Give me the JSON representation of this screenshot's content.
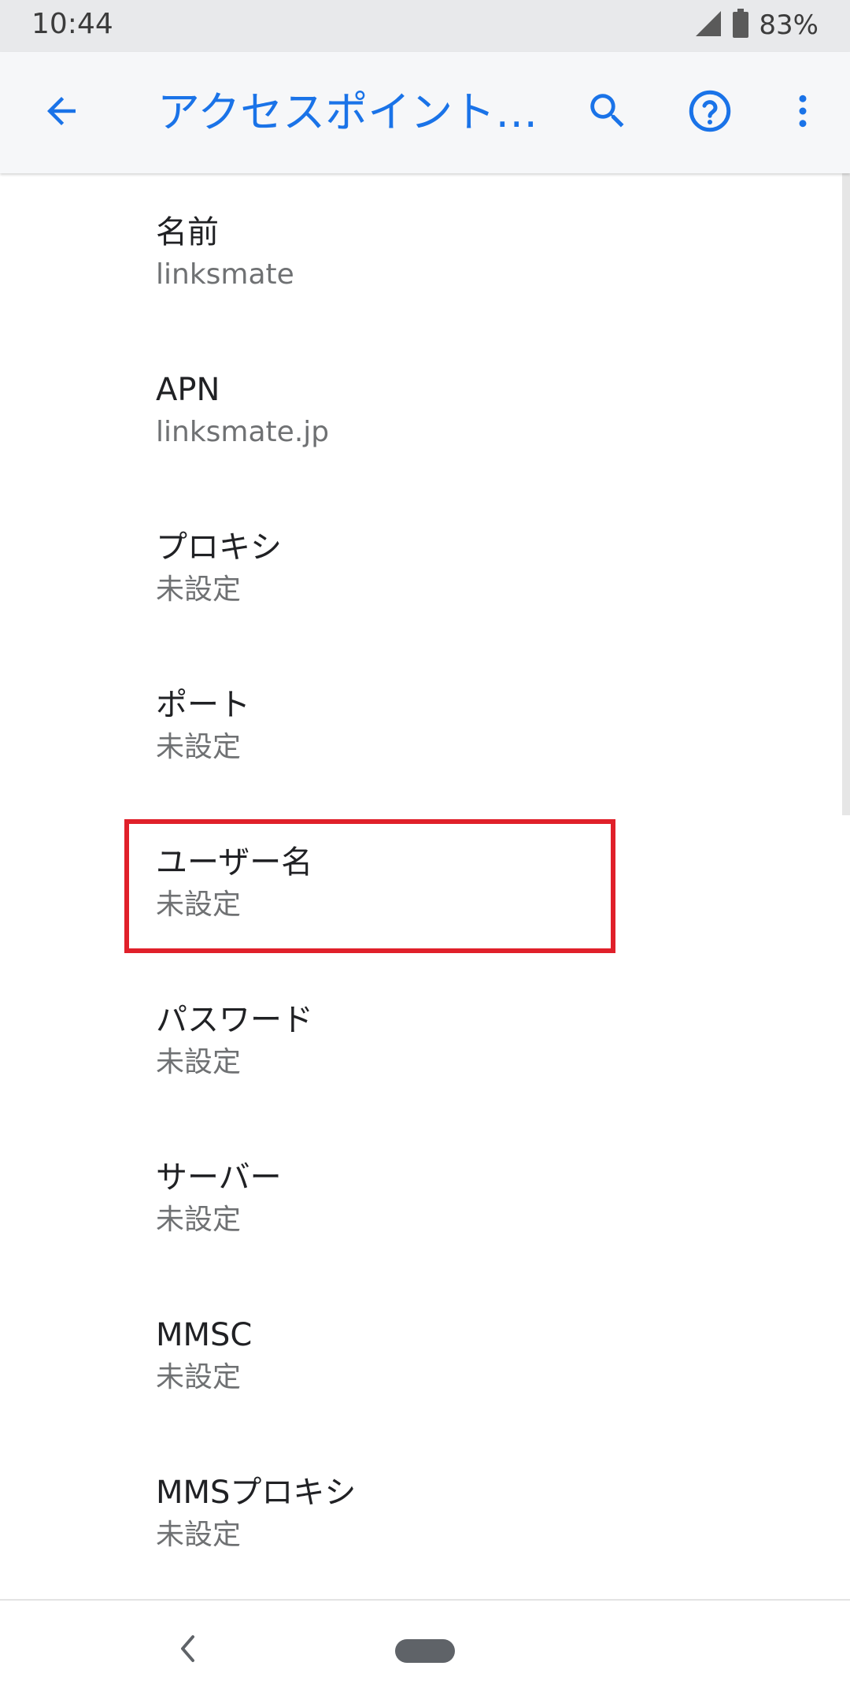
{
  "status_bar": {
    "time": "10:44",
    "battery": "83%",
    "icons": [
      "signal-icon",
      "battery-icon"
    ]
  },
  "app_bar": {
    "title": "アクセスポイント…",
    "icons": [
      "back-arrow-icon",
      "search-icon",
      "help-icon",
      "more-vert-icon"
    ],
    "accent_color": "#1a73e8"
  },
  "settings": [
    {
      "title": "名前",
      "summary": "linksmate"
    },
    {
      "title": "APN",
      "summary": "linksmate.jp"
    },
    {
      "title": "プロキシ",
      "summary": "未設定"
    },
    {
      "title": "ポート",
      "summary": "未設定"
    },
    {
      "title": "ユーザー名",
      "summary": "未設定"
    },
    {
      "title": "パスワード",
      "summary": "未設定"
    },
    {
      "title": "サーバー",
      "summary": "未設定"
    },
    {
      "title": "MMSC",
      "summary": "未設定"
    },
    {
      "title": "MMSプロキシ",
      "summary": "未設定"
    }
  ],
  "highlight": {
    "target": "ユーザー名",
    "color": "#e0202a"
  },
  "nav_bar": {
    "icons": [
      "nav-back-icon",
      "nav-home-pill-icon"
    ]
  }
}
